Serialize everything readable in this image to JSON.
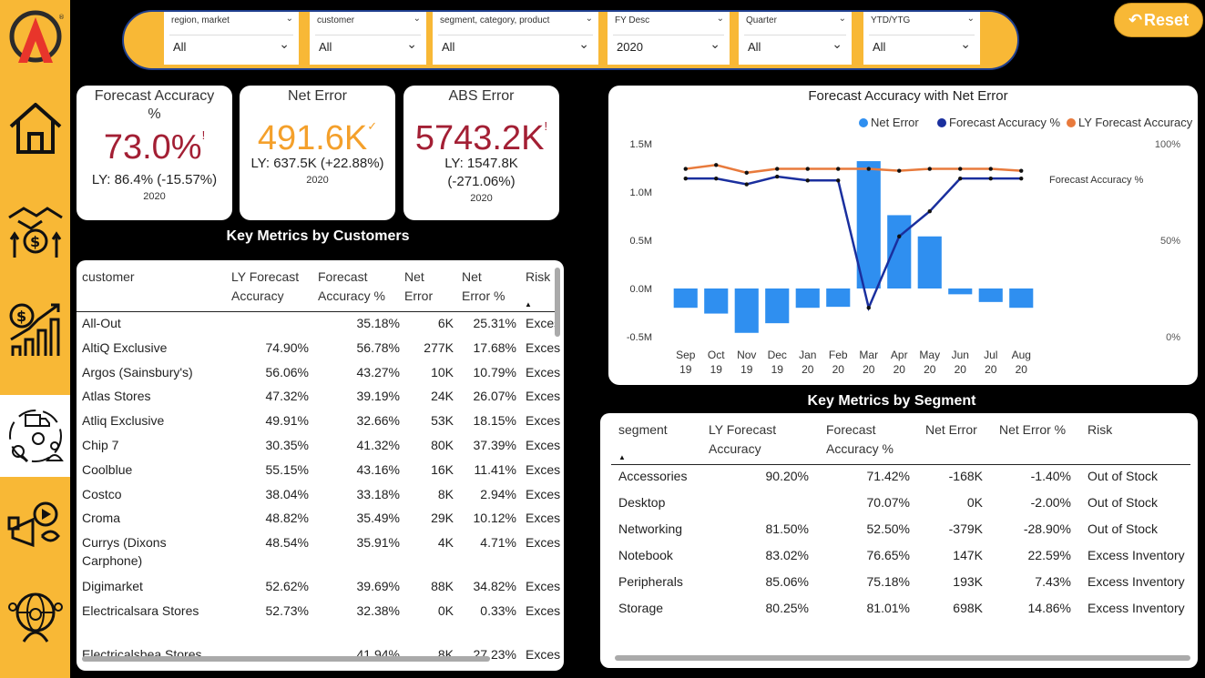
{
  "filters": [
    {
      "label": "region, market",
      "value": "All"
    },
    {
      "label": "customer",
      "value": "All"
    },
    {
      "label": "segment, category, product",
      "value": "All"
    },
    {
      "label": "FY Desc",
      "value": "2020"
    },
    {
      "label": "Quarter",
      "value": "All"
    },
    {
      "label": "YTD/YTG",
      "value": "All"
    }
  ],
  "reset_label": "Reset",
  "kpis": {
    "forecast_accuracy": {
      "title": "Forecast Accuracy %",
      "value": "73.0%",
      "flag": "!",
      "ly": "LY: 86.4% (-15.57%)",
      "year": "2020"
    },
    "net_error": {
      "title": "Net Error",
      "value": "491.6K",
      "flag": "✓",
      "ly": "LY: 637.5K (+22.88%)",
      "year": "2020"
    },
    "abs_error": {
      "title": "ABS Error",
      "value": "5743.2K",
      "flag": "!",
      "ly": "LY: 1547.8K (-271.06%)",
      "year": "2020"
    }
  },
  "customers_title": "Key Metrics by Customers",
  "customers": {
    "headers": [
      "customer",
      "LY Forecast Accuracy",
      "Forecast Accuracy %",
      "Net Error",
      "Net Error %",
      "Risk"
    ],
    "rows": [
      [
        "All-Out",
        "",
        "35.18%",
        "6K",
        "25.31%",
        "Exces"
      ],
      [
        "AltiQ Exclusive",
        "74.90%",
        "56.78%",
        "277K",
        "17.68%",
        "Exces"
      ],
      [
        "Argos (Sainsbury's)",
        "56.06%",
        "43.27%",
        "10K",
        "10.79%",
        "Exces"
      ],
      [
        "Atlas Stores",
        "47.32%",
        "39.19%",
        "24K",
        "26.07%",
        "Exces"
      ],
      [
        "Atliq Exclusive",
        "49.91%",
        "32.66%",
        "53K",
        "18.15%",
        "Exces"
      ],
      [
        "Chip 7",
        "30.35%",
        "41.32%",
        "80K",
        "37.39%",
        "Exces"
      ],
      [
        "Coolblue",
        "55.15%",
        "43.16%",
        "16K",
        "11.41%",
        "Exces"
      ],
      [
        "Costco",
        "38.04%",
        "33.18%",
        "8K",
        "2.94%",
        "Exces"
      ],
      [
        "Croma",
        "48.82%",
        "35.49%",
        "29K",
        "10.12%",
        "Exces"
      ],
      [
        "Currys (Dixons Carphone)",
        "48.54%",
        "35.91%",
        "4K",
        "4.71%",
        "Exces"
      ],
      [
        "Digimarket",
        "52.62%",
        "39.69%",
        "88K",
        "34.82%",
        "Exces"
      ],
      [
        "Electricalsara Stores",
        "52.73%",
        "32.38%",
        "0K",
        "0.33%",
        "Exces"
      ],
      [
        "Electricalsbea Stores",
        "",
        "41.94%",
        "8K",
        "27.23%",
        "Exces"
      ]
    ]
  },
  "segment_title": "Key Metrics by Segment",
  "segments": {
    "headers": [
      "segment",
      "LY Forecast Accuracy",
      "Forecast Accuracy %",
      "Net Error",
      "Net Error %",
      "Risk"
    ],
    "rows": [
      [
        "Accessories",
        "90.20%",
        "71.42%",
        "-168K",
        "-1.40%",
        "Out of Stock"
      ],
      [
        "Desktop",
        "",
        "70.07%",
        "0K",
        "-2.00%",
        "Out of Stock"
      ],
      [
        "Networking",
        "81.50%",
        "52.50%",
        "-379K",
        "-28.90%",
        "Out of Stock"
      ],
      [
        "Notebook",
        "83.02%",
        "76.65%",
        "147K",
        "22.59%",
        "Excess Inventory"
      ],
      [
        "Peripherals",
        "85.06%",
        "75.18%",
        "193K",
        "7.43%",
        "Excess Inventory"
      ],
      [
        "Storage",
        "80.25%",
        "81.01%",
        "698K",
        "14.86%",
        "Excess Inventory"
      ]
    ]
  },
  "chart_data": {
    "type": "bar",
    "title": "Forecast Accuracy with Net Error",
    "categories": [
      "Sep 19",
      "Oct 19",
      "Nov 19",
      "Dec 19",
      "Jan 20",
      "Feb 20",
      "Mar 20",
      "Apr 20",
      "May 20",
      "Jun 20",
      "Jul 20",
      "Aug 20"
    ],
    "y_ticks_left": [
      "1.5M",
      "1.0M",
      "0.5M",
      "0.0M",
      "-0.5M"
    ],
    "y_ticks_right": [
      "100%",
      "50%",
      "0%"
    ],
    "ylim_left": [
      -0.5,
      1.5
    ],
    "ylim_right": [
      0,
      1
    ],
    "right_axis_label": "Forecast Accuracy %",
    "legend_position": "top-right",
    "series": [
      {
        "name": "Net Error",
        "kind": "bar",
        "axis": "left",
        "color": "#2f8ff0",
        "values": [
          -0.2,
          -0.26,
          -0.46,
          -0.36,
          -0.2,
          -0.19,
          1.32,
          0.76,
          0.54,
          -0.06,
          -0.14,
          -0.2
        ]
      },
      {
        "name": "Forecast Accuracy %",
        "kind": "line",
        "axis": "right",
        "color": "#1a2f9e",
        "values": [
          0.82,
          0.82,
          0.79,
          0.83,
          0.81,
          0.81,
          0.15,
          0.52,
          0.65,
          0.82,
          0.82,
          0.82
        ]
      },
      {
        "name": "LY Forecast Accuracy",
        "kind": "line",
        "axis": "right",
        "color": "#e87a3c",
        "values": [
          0.87,
          0.89,
          0.85,
          0.87,
          0.87,
          0.87,
          0.87,
          0.86,
          0.87,
          0.87,
          0.87,
          0.86
        ]
      }
    ]
  },
  "colors": {
    "accent": "#f8b836",
    "kpi_red": "#a31f34",
    "kpi_orange": "#f4a02b",
    "navy": "#1f3f8f"
  }
}
